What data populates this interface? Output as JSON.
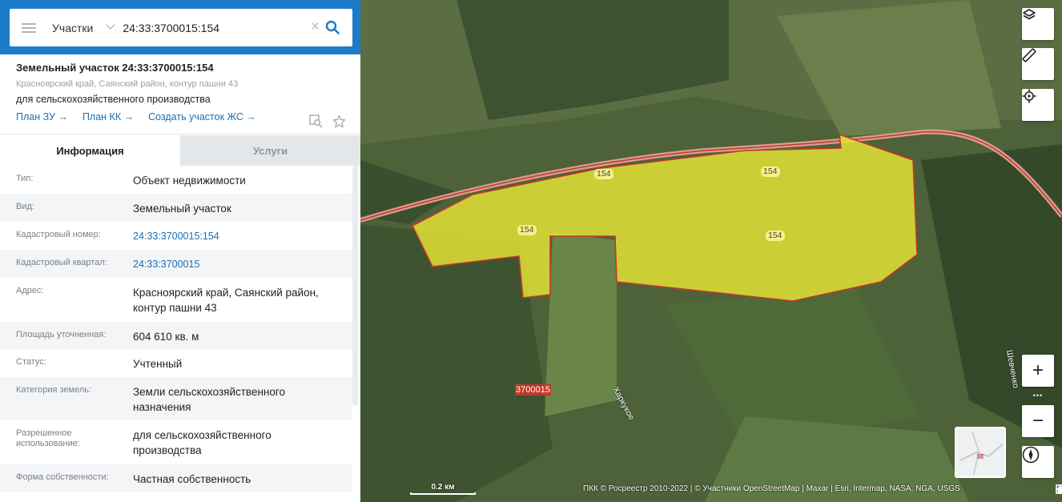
{
  "search": {
    "type_label": "Участки",
    "value": "24:33:3700015:154",
    "clear_glyph": "×"
  },
  "object": {
    "title": "Земельный участок 24:33:3700015:154",
    "address": "Красноярский край, Саянский район, контур пашни 43",
    "purpose": "для сельскохозяйственного производства",
    "links": [
      "План ЗУ →",
      "План КК →",
      "Создать участок ЖС →"
    ]
  },
  "tabs": {
    "info": "Информация",
    "services": "Услуги"
  },
  "info_rows": [
    {
      "label": "Тип:",
      "value": "Объект недвижимости"
    },
    {
      "label": "Вид:",
      "value": "Земельный участок"
    },
    {
      "label": "Кадастровый номер:",
      "value": "24:33:3700015:154"
    },
    {
      "label": "Кадастровый квартал:",
      "value": "24:33:3700015"
    },
    {
      "label": "Адрес:",
      "value": "Красноярский край, Саянский район, контур пашни 43"
    },
    {
      "label": "Площадь уточненная:",
      "value": "604 610 кв. м"
    },
    {
      "label": "Статус:",
      "value": "Учтенный"
    },
    {
      "label": "Категория земель:",
      "value": "Земли сельскохозяйственного назначения"
    },
    {
      "label": "Разрешенное использование:",
      "value": "для сельскохозяйственного производства"
    },
    {
      "label": "Форма собственности:",
      "value": "Частная собственность"
    }
  ],
  "map": {
    "parcel_labels": [
      "154",
      "154",
      "154",
      "154"
    ],
    "quarter_label": "3700015",
    "street_labels": [
      "Харкукое",
      "Шевченко"
    ],
    "scale": "0.2 км",
    "attribution": "ПКК © Росреестр 2010-2022 | © Участники OpenStreetMap | Maxar | Esri, Intermap, NASA, NGA, USGS",
    "zoom_in": "+",
    "zoom_out": "−",
    "more": "•••",
    "icons": [
      "layers-icon",
      "ruler-icon",
      "locate-icon",
      "compass-icon",
      "home-icon",
      "crosshair-icon",
      "fullscreen-icon"
    ]
  },
  "colors": {
    "header_blue": "#1c7cc9",
    "link_blue": "#1c6eb4",
    "parcel_fill": "#e8e636",
    "parcel_stroke": "#c0392b",
    "road": "#d99d8e"
  }
}
